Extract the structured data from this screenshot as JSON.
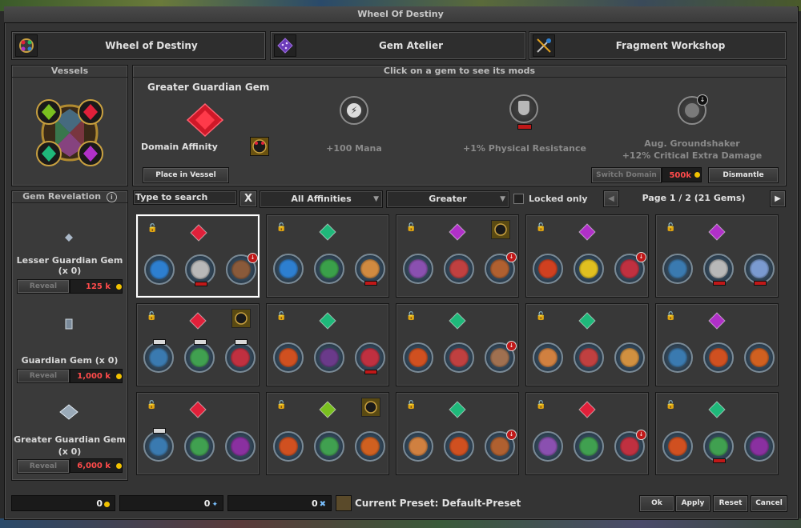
{
  "window": {
    "title": "Wheel Of Destiny"
  },
  "tabs": [
    {
      "label": "Wheel of Destiny",
      "icon": "wheel-icon"
    },
    {
      "label": "Gem Atelier",
      "icon": "gem-dice-icon"
    },
    {
      "label": "Fragment Workshop",
      "icon": "fragment-tools-icon"
    }
  ],
  "vessels": {
    "title": "Vessels"
  },
  "detail": {
    "header": "Click on a gem to see its mods",
    "gem_name": "Greater Guardian Gem",
    "domain_label": "Domain Affinity",
    "place_button": "Place in Vessel",
    "mods": [
      {
        "text": "+100 Mana",
        "icon": "lightning-mod-icon"
      },
      {
        "text": "+1% Physical Resistance",
        "icon": "shield-mod-icon"
      },
      {
        "text": "Aug. Groundshaker",
        "text2": "+12% Critical Extra Damage",
        "icon": "groundshaker-mod-icon"
      }
    ],
    "switch_domain": "Switch Domain",
    "switch_price": "500k",
    "dismantle": "Dismantle"
  },
  "revelation": {
    "title": "Gem Revelation",
    "info_icon": "i",
    "items": [
      {
        "name": "Lesser Guardian Gem (x 0)",
        "reveal": "Reveal",
        "price": "125 k"
      },
      {
        "name": "Guardian Gem (x 0)",
        "reveal": "Reveal",
        "price": "1,000 k"
      },
      {
        "name": "Greater Guardian Gem (x 0)",
        "reveal": "Reveal",
        "price": "6,000 k"
      }
    ]
  },
  "filters": {
    "search_placeholder": "Type to search",
    "clear": "X",
    "affinity": "All Affinities",
    "quality": "Greater",
    "locked_only": "Locked only",
    "page": "Page 1 / 2 (21 Gems)"
  },
  "gems": [
    {
      "color": "#e0203a",
      "mods": [
        "#2d7fd0",
        "#b8b8b8",
        "#8a5a3a"
      ],
      "badges": [
        0,
        1,
        2
      ]
    },
    {
      "color": "#1fb87a",
      "mods": [
        "#2d7fd0",
        "#3aa04a",
        "#d08a40"
      ],
      "badges": [
        0,
        0,
        1
      ]
    },
    {
      "color": "#b030c8",
      "mods": [
        "#8a50b0",
        "#c04040",
        "#b06030"
      ],
      "badges": [
        0,
        0,
        2
      ],
      "domain": true
    },
    {
      "color": "#b030c8",
      "mods": [
        "#d04020",
        "#e0c020",
        "#c03040"
      ],
      "badges": [
        0,
        0,
        2
      ]
    },
    {
      "color": "#b030c8",
      "mods": [
        "#3a7ab0",
        "#b8b8b8",
        "#7a9ad0"
      ],
      "badges": [
        0,
        1,
        1
      ]
    },
    {
      "color": "#e0203a",
      "mods": [
        "#3a7ab0",
        "#40a050",
        "#c03040"
      ],
      "badges": [
        3,
        3,
        3
      ],
      "domain": true
    },
    {
      "color": "#1fb87a",
      "mods": [
        "#d05020",
        "#6a3a8a",
        "#c03040"
      ],
      "badges": [
        0,
        0,
        1
      ]
    },
    {
      "color": "#1fb87a",
      "mods": [
        "#d05020",
        "#c04040",
        "#a07050"
      ],
      "badges": [
        0,
        0,
        2
      ]
    },
    {
      "color": "#1fb87a",
      "mods": [
        "#d08040",
        "#c04040",
        "#d09040"
      ],
      "badges": [
        0,
        0,
        0
      ]
    },
    {
      "color": "#b030c8",
      "mods": [
        "#3a7ab0",
        "#d05020",
        "#d06020"
      ],
      "badges": [
        0,
        0,
        0
      ]
    },
    {
      "color": "#e0203a",
      "mods": [
        "#3a7ab0",
        "#40a050",
        "#8a30a0"
      ],
      "badges": [
        3,
        0,
        0
      ]
    },
    {
      "color": "#7ac020",
      "mods": [
        "#d05020",
        "#40a050",
        "#d06020"
      ],
      "badges": [
        0,
        0,
        0
      ],
      "domain": true
    },
    {
      "color": "#1fb87a",
      "mods": [
        "#d08040",
        "#d05020",
        "#b06030"
      ],
      "badges": [
        0,
        0,
        2
      ]
    },
    {
      "color": "#e0203a",
      "mods": [
        "#8a50b0",
        "#40a050",
        "#c03040"
      ],
      "badges": [
        0,
        0,
        2
      ]
    },
    {
      "color": "#1fb87a",
      "mods": [
        "#d05020",
        "#40a050",
        "#8a30a0"
      ],
      "badges": [
        0,
        1,
        0
      ]
    }
  ],
  "footer": {
    "value1": "0",
    "value2": "0",
    "value3": "0",
    "preset": "Current Preset: Default-Preset",
    "ok": "Ok",
    "apply": "Apply",
    "reset": "Reset",
    "cancel": "Cancel"
  },
  "colors": {
    "price_red": "#ff4b4b",
    "gold": "#f2c200",
    "selected_border": "#ffffff"
  }
}
